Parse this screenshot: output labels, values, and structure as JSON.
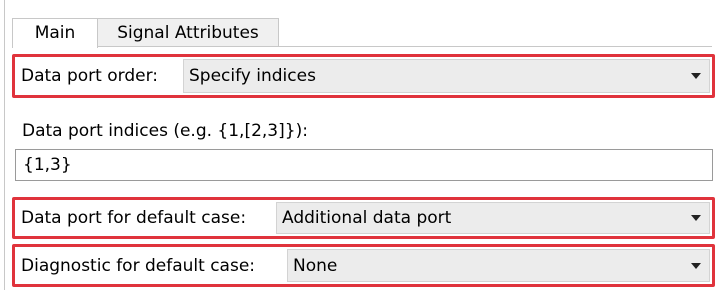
{
  "tabs": [
    {
      "label": "Main",
      "active": true
    },
    {
      "label": "Signal Attributes",
      "active": false
    }
  ],
  "data_port_order": {
    "label": "Data port order:",
    "value": "Specify indices"
  },
  "data_port_indices": {
    "label": "Data port indices (e.g. {1,[2,3]}):",
    "value": "{1,3}"
  },
  "default_case_port": {
    "label": "Data port for default case:",
    "value": "Additional data port"
  },
  "default_case_diagnostic": {
    "label": "Diagnostic for default case:",
    "value": "None"
  },
  "colors": {
    "highlight": "#e0333c",
    "dropdown_bg": "#ececec",
    "tab_inactive_bg": "#f0f0f0",
    "border": "#c8c8c8"
  },
  "icons": {
    "dropdown_caret": "chevron-down-icon"
  }
}
